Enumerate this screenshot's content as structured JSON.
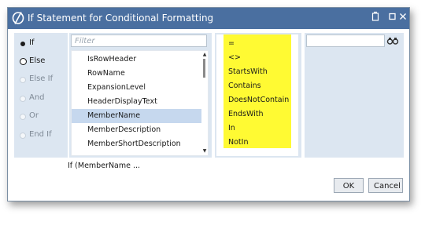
{
  "window": {
    "title": "If Statement for Conditional Formatting",
    "colors": {
      "titlebar": "#4a6fa0",
      "panel": "#dce6f1",
      "highlight": "#fffa33",
      "selection": "#c6d8ee"
    }
  },
  "conditions": {
    "options": [
      {
        "label": "If",
        "state": "selected"
      },
      {
        "label": "Else",
        "state": "active"
      },
      {
        "label": "Else If",
        "state": "disabled"
      },
      {
        "label": "And",
        "state": "disabled"
      },
      {
        "label": "Or",
        "state": "disabled"
      },
      {
        "label": "End If",
        "state": "disabled"
      }
    ]
  },
  "members": {
    "filter_placeholder": "Filter",
    "items": [
      "IsRowHeader",
      "RowName",
      "ExpansionLevel",
      "HeaderDisplayText",
      "MemberName",
      "MemberDescription",
      "MemberShortDescription"
    ],
    "selected": "MemberName"
  },
  "operators": {
    "items": [
      "=",
      "<>",
      "StartsWith",
      "Contains",
      "DoesNotContain",
      "EndsWith",
      "In",
      "NotIn"
    ]
  },
  "value": {
    "input": ""
  },
  "expression": "If (MemberName ...",
  "buttons": {
    "ok": "OK",
    "cancel": "Cancel"
  },
  "icons": {
    "app": "app-logo-icon",
    "restore": "restore-icon",
    "maximize": "maximize-icon",
    "close": "close-icon",
    "search": "binoculars-icon"
  }
}
